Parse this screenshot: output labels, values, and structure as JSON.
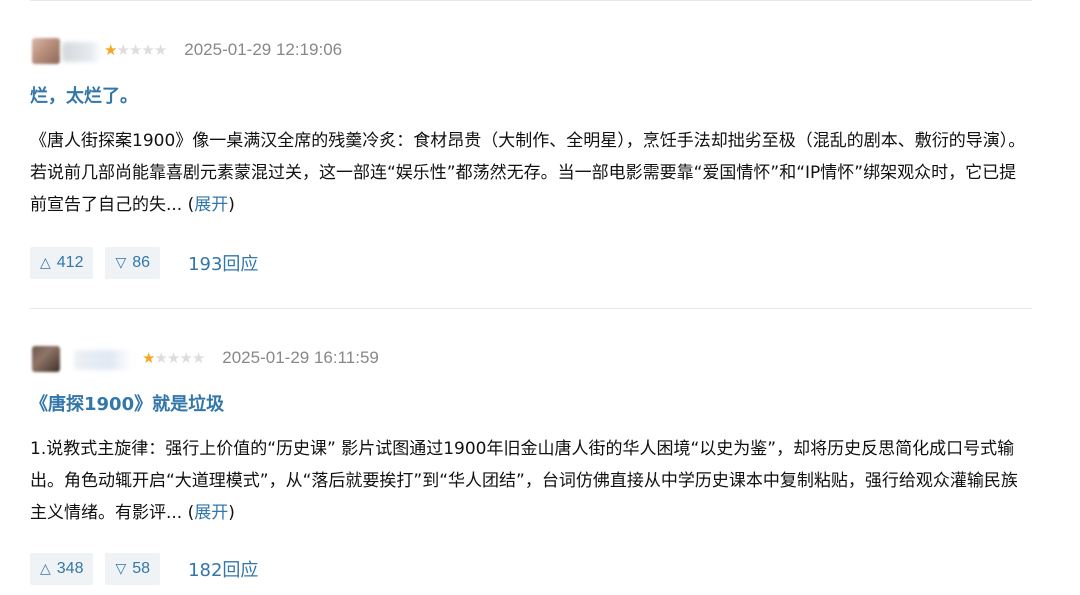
{
  "reviews": [
    {
      "rating_stars": 1,
      "rating_max": 5,
      "timestamp": "2025-01-29 12:19:06",
      "title": "烂，太烂了。",
      "body": "《唐人街探案1900》像一桌满汉全席的残羹冷炙：食材昂贵（大制作、全明星），烹饪手法却拙劣至极（混乱的剧本、敷衍的导演）。若说前几部尚能靠喜剧元素蒙混过关，这一部连“娱乐性”都荡然无存。当一部电影需要靠“爱国情怀”和“IP情怀”绑架观众时，它已提前宣告了自己的失...",
      "expand_open": "(",
      "expand_label": "展开",
      "expand_close": ")",
      "upvotes": "412",
      "downvotes": "86",
      "replies": "193回应"
    },
    {
      "rating_stars": 1,
      "rating_max": 5,
      "timestamp": "2025-01-29 16:11:59",
      "title": "《唐探1900》就是垃圾",
      "body": "1.说教式主旋律：强行上价值的“历史课” 影片试图通过1900年旧金山唐人街的华人困境“以史为鉴”，却将历史反思简化成口号式输出。角色动辄开启“大道理模式”，从“落后就要挨打”到“华人团结”，台词仿佛直接从中学历史课本中复制粘贴，强行给观众灌输民族主义情绪。有影评...",
      "expand_open": "(",
      "expand_label": "展开",
      "expand_close": ")",
      "upvotes": "348",
      "downvotes": "58",
      "replies": "182回应"
    }
  ],
  "icons": {
    "upvote": "up-triangle-icon",
    "downvote": "down-triangle-icon",
    "star": "star-icon"
  },
  "colors": {
    "link": "#3377aa",
    "star_on": "#f5a623",
    "star_off": "#dddddd",
    "timestamp": "#888888",
    "vote_bg": "#f0f3f5"
  }
}
